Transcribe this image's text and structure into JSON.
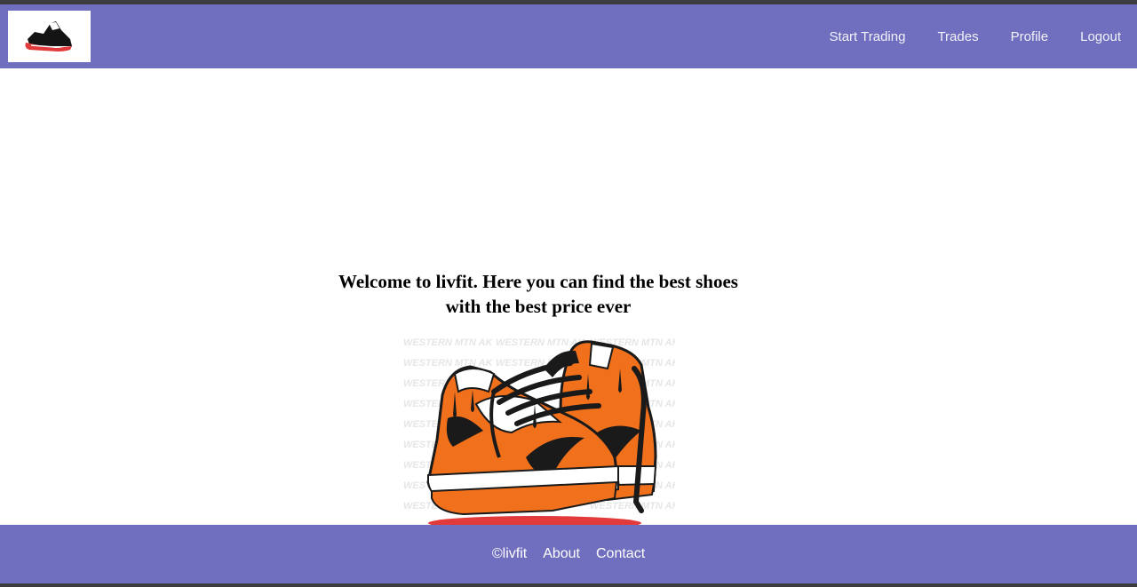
{
  "colors": {
    "header_bg": "#706ebe",
    "footer_bg": "#706ebe",
    "frame": "#3d3d3f",
    "nav_text": "#f2f2fa",
    "shoe_orange": "#f0701c",
    "shoe_black": "#1a1a1a",
    "accent_red": "#e23a3a"
  },
  "header": {
    "logo_icon": "sneaker-logo-icon",
    "nav": [
      {
        "label": "Start Trading"
      },
      {
        "label": "Trades"
      },
      {
        "label": "Profile"
      },
      {
        "label": "Logout"
      }
    ]
  },
  "main": {
    "welcome": "Welcome to livfit. Here you can find the best shoes with the best price ever",
    "hero_image": "orange-sneakers-illustration",
    "background_watermark": "WESTERN MTN AK"
  },
  "footer": {
    "copyright": "©livfit",
    "links": [
      {
        "label": "About"
      },
      {
        "label": "Contact"
      }
    ]
  }
}
